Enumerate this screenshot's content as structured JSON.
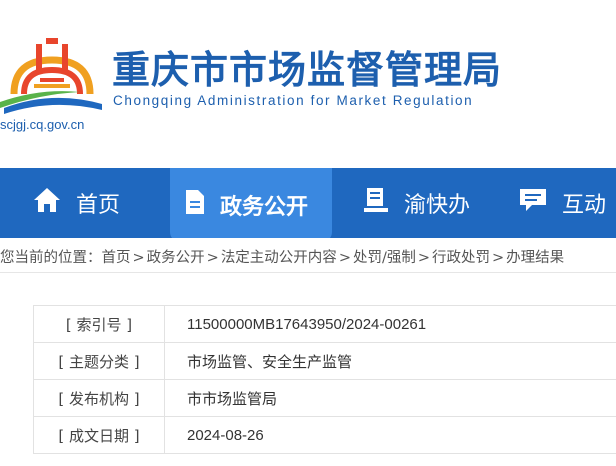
{
  "site": {
    "title": "重庆市市场监督管理局",
    "subtitle": "Chongqing  Administration for Market Regulation",
    "domain": "scjgj.cq.gov.cn"
  },
  "nav": [
    {
      "label": "首页",
      "icon": "home-icon",
      "active": false
    },
    {
      "label": "政务公开",
      "icon": "document-icon",
      "active": true
    },
    {
      "label": "渝快办",
      "icon": "service-desk-icon",
      "active": false
    },
    {
      "label": "互动",
      "icon": "chat-icon",
      "active": false
    }
  ],
  "breadcrumb": {
    "prefix": "您当前的位置：",
    "items": [
      "首页",
      "政务公开",
      "法定主动公开内容",
      "处罚/强制",
      "行政处罚",
      "办理结果"
    ]
  },
  "info": [
    {
      "key": "[ 索引号 ]",
      "value": "11500000MB17643950/2024-00261"
    },
    {
      "key": "[ 主题分类 ]",
      "value": "市场监管、安全生产监管"
    },
    {
      "key": "[ 发布机构 ]",
      "value": "市市场监管局"
    },
    {
      "key": "[ 成文日期 ]",
      "value": "2024-08-26"
    }
  ],
  "colors": {
    "brand": "#1d5fae",
    "nav": "#1f68bf",
    "nav_active": "#3a88e0"
  }
}
